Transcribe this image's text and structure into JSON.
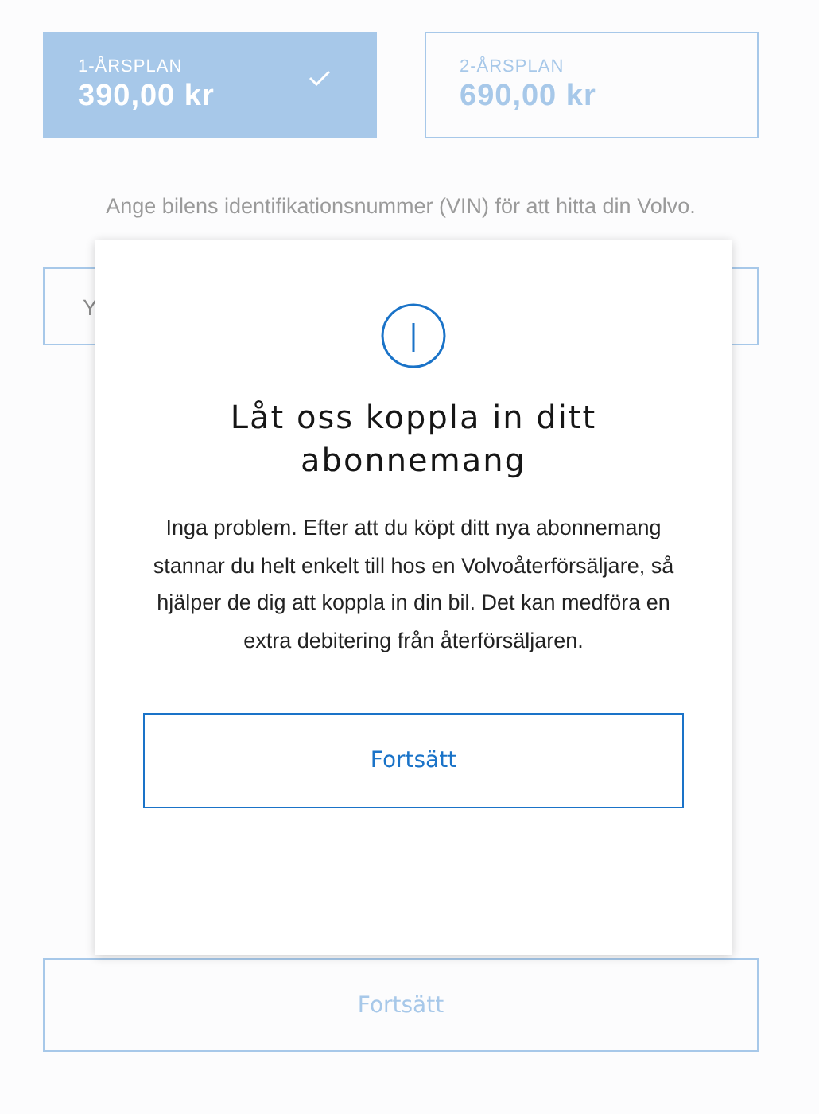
{
  "plans": [
    {
      "label": "1-ÅRSPLAN",
      "price": "390,00 kr",
      "selected": true
    },
    {
      "label": "2-ÅRSPLAN",
      "price": "690,00 kr",
      "selected": false
    }
  ],
  "vin_hint": "Ange bilens identifikationsnummer (VIN) för att hitta din Volvo.",
  "vin_field": {
    "placeholder": "Y"
  },
  "continue_button": {
    "label": "Fortsätt",
    "disabled": true
  },
  "dialog": {
    "title": "Låt oss koppla in ditt abonnemang",
    "body": "Inga problem. Efter att du köpt ditt nya abonnemang stannar du helt enkelt till hos en Volvoåterförsäljare, så hjälper de dig att koppla in din bil. Det kan medföra en extra debitering från återförsäljaren.",
    "button": "Fortsätt"
  }
}
